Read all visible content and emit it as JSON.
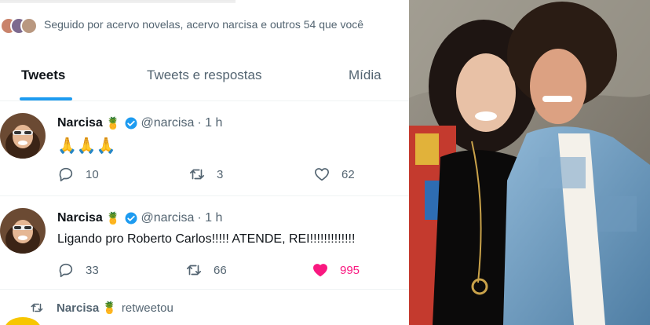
{
  "header": {
    "followed_by": "Seguido por acervo novelas, acervo narcisa e outros 54 que você"
  },
  "tabs": [
    {
      "label": "Tweets",
      "active": true
    },
    {
      "label": "Tweets e respostas",
      "active": false
    },
    {
      "label": "Mídia",
      "active": false
    }
  ],
  "tweets": [
    {
      "name": "Narcisa",
      "name_emoji": "🍍",
      "handle": "@narcisa",
      "time": "· 1 h",
      "text": "🙏🙏🙏",
      "replies": "10",
      "retweets": "3",
      "likes": "62",
      "liked": false
    },
    {
      "name": "Narcisa",
      "name_emoji": "🍍",
      "handle": "@narcisa",
      "time": "· 1 h",
      "text": "Ligando pro Roberto Carlos!!!!! ATENDE, REI!!!!!!!!!!!!!",
      "replies": "33",
      "retweets": "66",
      "likes": "995",
      "liked": true
    }
  ],
  "retweet_row": {
    "name": "Narcisa",
    "name_emoji": "🍍",
    "label": "retweetou"
  },
  "colors": {
    "accent": "#1d9bf0",
    "like": "#f91880",
    "muted": "#536471"
  },
  "icons": [
    "reply-icon",
    "retweet-icon",
    "like-icon",
    "verified-icon"
  ]
}
